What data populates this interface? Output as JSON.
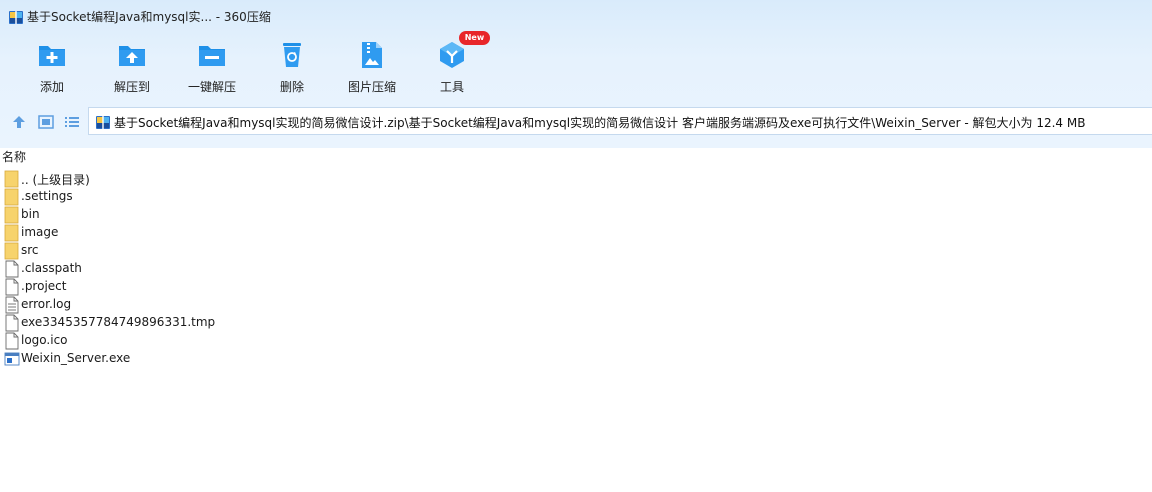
{
  "window": {
    "title": "基于Socket编程Java和mysql实... - 360压缩"
  },
  "toolbar": {
    "items": [
      {
        "label": "添加",
        "icon": "folder-plus-icon"
      },
      {
        "label": "解压到",
        "icon": "folder-extract-icon"
      },
      {
        "label": "一键解压",
        "icon": "folder-oneclick-extract-icon"
      },
      {
        "label": "删除",
        "icon": "recycle-bin-icon"
      },
      {
        "label": "图片压缩",
        "icon": "image-compress-icon"
      },
      {
        "label": "工具",
        "icon": "tools-cube-icon",
        "badge": "New"
      }
    ]
  },
  "navigation": {
    "path": "基于Socket编程Java和mysql实现的简易微信设计.zip\\基于Socket编程Java和mysql实现的简易微信设计 客户端服务端源码及exe可执行文件\\Weixin_Server - 解包大小为 12.4 MB"
  },
  "file_list": {
    "column_name": "名称",
    "rows": [
      {
        "name": ".. (上级目录)",
        "type": "folder"
      },
      {
        "name": ".settings",
        "type": "folder"
      },
      {
        "name": "bin",
        "type": "folder"
      },
      {
        "name": "image",
        "type": "folder"
      },
      {
        "name": "src",
        "type": "folder"
      },
      {
        "name": ".classpath",
        "type": "file"
      },
      {
        "name": ".project",
        "type": "file"
      },
      {
        "name": "error.log",
        "type": "text"
      },
      {
        "name": "exe3345357784749896331.tmp",
        "type": "file"
      },
      {
        "name": "logo.ico",
        "type": "file"
      },
      {
        "name": "Weixin_Server.exe",
        "type": "exe"
      }
    ]
  },
  "colors": {
    "accent": "#1e90e8",
    "folder": "#f7d36c",
    "badge": "#e8262a"
  }
}
